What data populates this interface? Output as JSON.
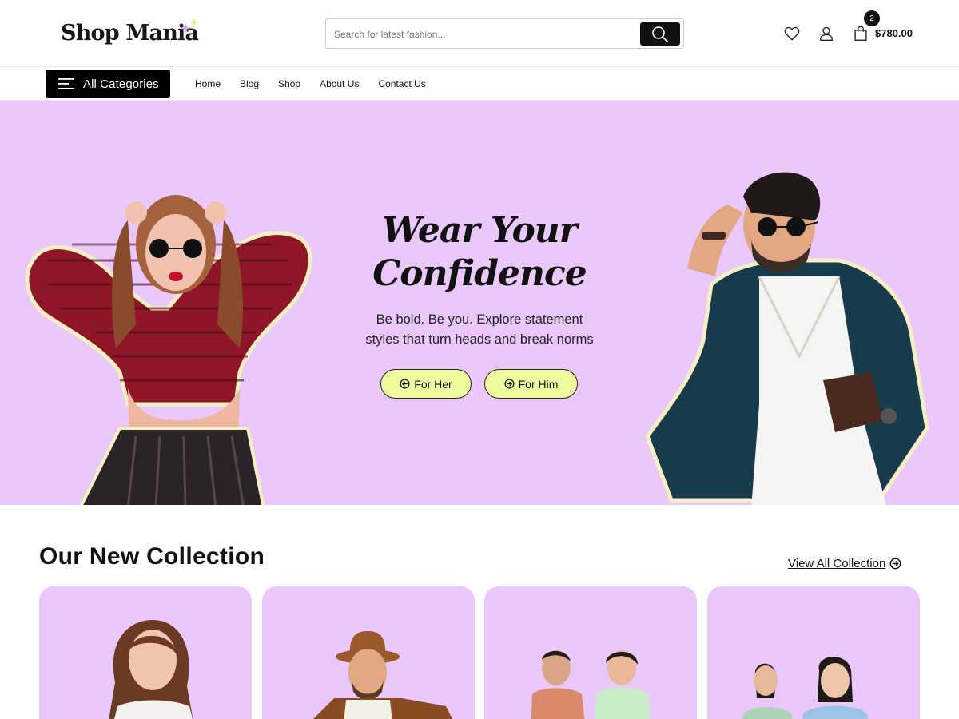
{
  "header": {
    "logo_text": "Shop Mania",
    "search_placeholder": "Search for latest fashion...",
    "cart_count": "2",
    "cart_total": "$780.00",
    "icons": [
      "search-icon",
      "heart-icon",
      "user-icon",
      "shopping-bag-icon"
    ]
  },
  "nav": {
    "all_categories_label": "All Categories",
    "links": [
      "Home",
      "Blog",
      "Shop",
      "About Us",
      "Contact Us"
    ]
  },
  "hero": {
    "title_line1": "Wear Your",
    "title_line2": "Confidence",
    "subtitle_line1": "Be bold. Be you. Explore statement",
    "subtitle_line2": "styles that turn heads and break norms",
    "btn_her": "For Her",
    "btn_him": "For Him"
  },
  "collection": {
    "title": "Our New Collection",
    "view_all": "View All Collection"
  },
  "colors": {
    "hero_bg": "#eac8fb",
    "button_bg": "#eefc9e",
    "dark": "#111111"
  }
}
